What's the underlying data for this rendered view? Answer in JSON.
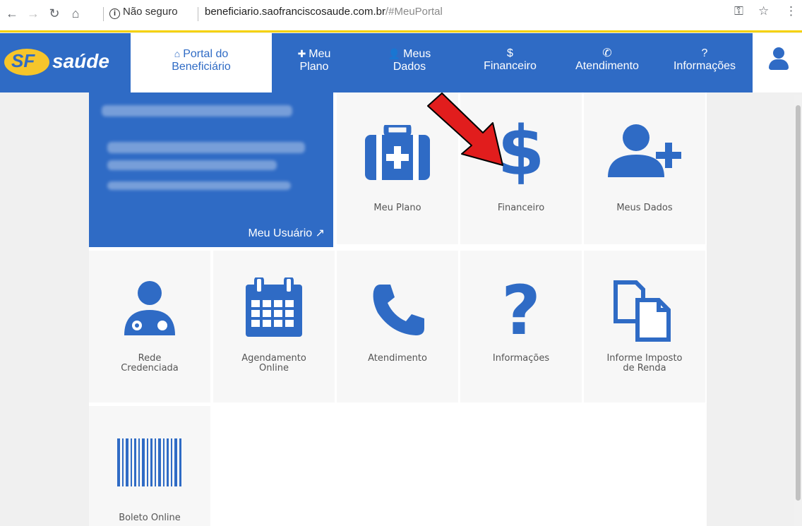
{
  "browser": {
    "security": "Não seguro",
    "url_domain": "beneficiario.saofranciscosaude.com.br",
    "url_path": "/#MeuPortal"
  },
  "header": {
    "logo_text": "saúde",
    "logo_mark": "SF",
    "tabs": [
      {
        "label1": "Portal do",
        "label2": "Beneficiário",
        "icon": "home-icon"
      },
      {
        "label1": "Meu",
        "label2": "Plano",
        "icon": "medkit-icon"
      },
      {
        "label1": "Meus",
        "label2": "Dados",
        "icon": "user-plus-icon"
      },
      {
        "label1": "$",
        "label2": "Financeiro",
        "icon": "dollar-icon"
      },
      {
        "label1": "",
        "label2": "Atendimento",
        "icon": "phone-icon"
      },
      {
        "label1": "?",
        "label2": "Informações",
        "icon": "question-icon"
      }
    ]
  },
  "user_card": {
    "link": "Meu Usuário"
  },
  "cards": {
    "meu_plano": "Meu Plano",
    "financeiro": "Financeiro",
    "meus_dados": "Meus Dados",
    "rede_1": "Rede",
    "rede_2": "Credenciada",
    "agend_1": "Agendamento",
    "agend_2": "Online",
    "atendimento": "Atendimento",
    "informacoes": "Informações",
    "informe_1": "Informe Imposto",
    "informe_2": "de Renda",
    "boleto": "Boleto Online"
  },
  "colors": {
    "brand": "#2f6bc5",
    "accent": "#f5d200",
    "arrow": "#e11d1d"
  }
}
